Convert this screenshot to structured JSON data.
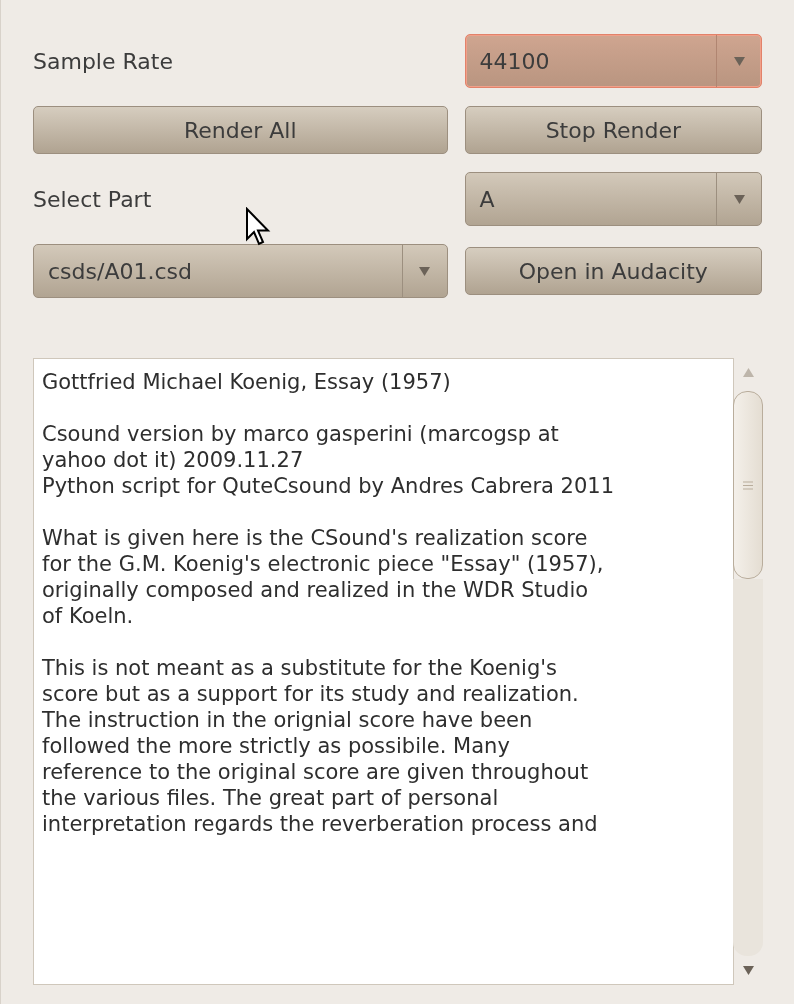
{
  "rows": [
    {
      "left": {
        "kind": "label",
        "text": "Sample Rate"
      },
      "right": {
        "kind": "combo",
        "text": "44100",
        "highlighted": true
      }
    },
    {
      "left": {
        "kind": "button",
        "text": "Render All"
      },
      "right": {
        "kind": "button",
        "text": "Stop Render"
      }
    },
    {
      "left": {
        "kind": "label",
        "text": "Select Part"
      },
      "right": {
        "kind": "combo",
        "text": "A",
        "highlighted": false
      }
    },
    {
      "left": {
        "kind": "combo",
        "text": "csds/A01.csd",
        "highlighted": false
      },
      "right": {
        "kind": "button",
        "text": "Open in Audacity"
      }
    }
  ],
  "text_area": {
    "paragraphs": [
      {
        "lines": [
          "Gottfried Michael Koenig, Essay (1957)"
        ]
      },
      {
        "lines": [
          "Csound version by marco gasperini (marcogsp at",
          "yahoo dot it) 2009.11.27",
          "Python script for QuteCsound by Andres Cabrera 2011"
        ]
      },
      {
        "lines": [
          "What is given here is the CSound's realization score",
          "for the G.M. Koenig's electronic piece \"Essay\" (1957),",
          "originally composed and realized in the WDR Studio",
          "of Koeln."
        ]
      },
      {
        "lines": [
          "This is not meant as a substitute for the Koenig's",
          "score but as a support for its study and realization.",
          "The instruction in the orignial score have been",
          "followed the more strictly as possibile. Many",
          "reference to the original score are given throughout",
          "the various files. The great part of personal",
          "interpretation regards the reverberation process and"
        ]
      }
    ]
  }
}
